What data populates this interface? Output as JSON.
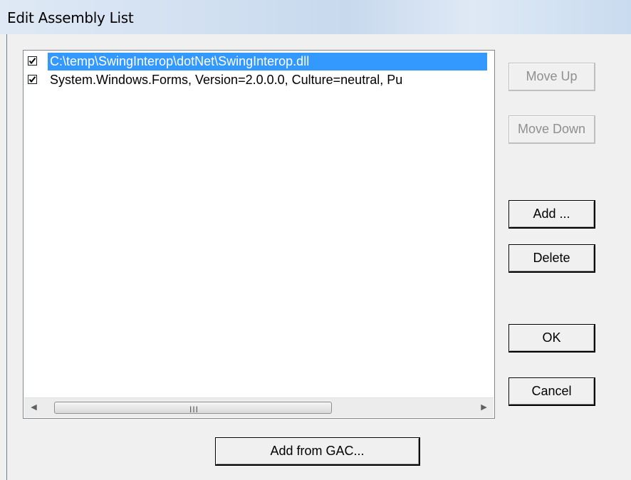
{
  "window": {
    "title": "Edit Assembly List"
  },
  "assemblies": [
    {
      "label": "C:\\temp\\SwingInterop\\dotNet\\SwingInterop.dll",
      "checked": true,
      "selected": true
    },
    {
      "label": "System.Windows.Forms, Version=2.0.0.0, Culture=neutral, Pu",
      "checked": true,
      "selected": false
    }
  ],
  "scrollbar": {
    "grip": "III"
  },
  "buttons": {
    "move_up": "Move Up",
    "move_down": "Move Down",
    "add": "Add ...",
    "delete": "Delete",
    "ok": "OK",
    "cancel": "Cancel",
    "add_from_gac": "Add from GAC..."
  },
  "colors": {
    "selection": "#3399ff",
    "window_bg": "#f0f0f0"
  }
}
